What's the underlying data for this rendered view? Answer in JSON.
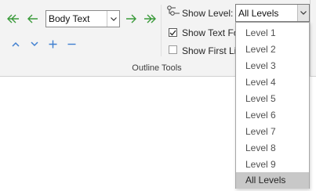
{
  "ribbon": {
    "group_title": "Outline Tools",
    "buttons": [
      {
        "name": "promote-to-heading1-button",
        "icon": "double-arrow-left-icon"
      },
      {
        "name": "promote-button",
        "icon": "arrow-left-icon"
      },
      {
        "name": "demote-button",
        "icon": "arrow-right-icon"
      },
      {
        "name": "demote-to-body-text-button",
        "icon": "double-arrow-right-icon"
      },
      {
        "name": "move-up-button",
        "icon": "chevron-up-icon"
      },
      {
        "name": "move-down-button",
        "icon": "chevron-down-icon"
      },
      {
        "name": "expand-button",
        "icon": "plus-icon"
      },
      {
        "name": "collapse-button",
        "icon": "minus-icon"
      }
    ],
    "outline_level": {
      "value": "Body Text"
    },
    "show_level": {
      "label": "Show Level:",
      "value": "All Levels"
    },
    "show_text_formatting": {
      "label": "Show Text Fo",
      "checked": true
    },
    "show_first_line": {
      "label": "Show First Lin",
      "checked": false
    }
  },
  "dropdown": {
    "items": [
      "Level 1",
      "Level 2",
      "Level 3",
      "Level 4",
      "Level 5",
      "Level 6",
      "Level 7",
      "Level 8",
      "Level 9",
      "All Levels"
    ],
    "selected": "All Levels"
  },
  "colors": {
    "arrow_green": "#3a9a3a",
    "nav_blue": "#3f7fd0",
    "selected_bg": "#c8c8c8"
  }
}
